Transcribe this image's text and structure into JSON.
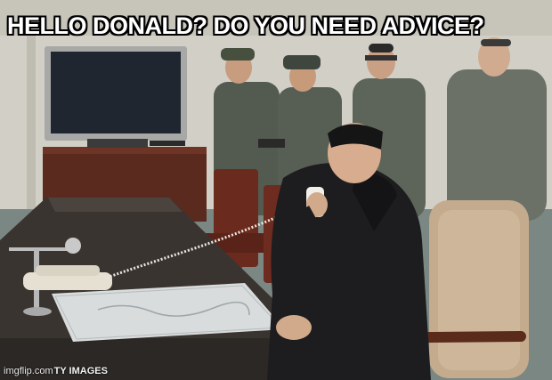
{
  "meme": {
    "caption": "HELLO DONALD? DO YOU NEED ADVICE?",
    "watermark_site": "imgflip.com",
    "watermark_stock": "TY IMAGES"
  },
  "colors": {
    "wall": "#d4d1c8",
    "floor": "#7d8a86",
    "table": "#3a3430",
    "uniform": "#535a50",
    "coat": "#1d1d1f",
    "chair_leather": "#6b2a1e",
    "chair_beige": "#c4ab8e"
  }
}
